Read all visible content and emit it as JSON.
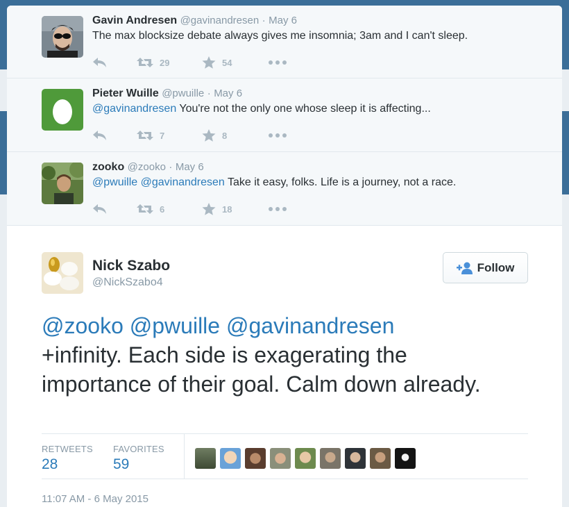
{
  "replies": [
    {
      "name": "Gavin Andresen",
      "handle": "@gavinandresen",
      "date": "May 6",
      "mentions": "",
      "text": "The max blocksize debate always gives me insomnia; 3am and I can't sleep.",
      "retweets": "29",
      "favorites": "54",
      "avatar_icon": "man-with-sunglasses-avatar"
    },
    {
      "name": "Pieter Wuille",
      "handle": "@pwuille",
      "date": "May 6",
      "mentions": "@gavinandresen",
      "text": " You're not the only one whose sleep it is affecting...",
      "retweets": "7",
      "favorites": "8",
      "avatar_icon": "default-egg-avatar"
    },
    {
      "name": "zooko",
      "handle": "@zooko",
      "date": "May 6",
      "mentions": "@pwuille @gavinandresen",
      "text": " Take it easy, folks. Life is a journey, not a race.",
      "retweets": "6",
      "favorites": "18",
      "avatar_icon": "man-outdoors-avatar"
    }
  ],
  "separator": "·",
  "main_tweet": {
    "name": "Nick Szabo",
    "handle": "@NickSzabo4",
    "follow_label": "Follow",
    "mentions": "@zooko @pwuille @gavinandresen",
    "text": "+infinity.  Each side is exagerating the importance of their goal. Calm down already.",
    "retweets_label": "RETWEETS",
    "retweets": "28",
    "favorites_label": "FAVORITES",
    "favorites": "59",
    "timestamp": "11:07 AM - 6 May 2015",
    "avatar_icon": "golden-egg-avatar"
  },
  "colors": {
    "link": "#2b7bb9",
    "muted": "#8899a6",
    "action_icon": "#aab8c2",
    "reply_bg": "#f5f8fa",
    "backdrop": "#3b6e98"
  }
}
